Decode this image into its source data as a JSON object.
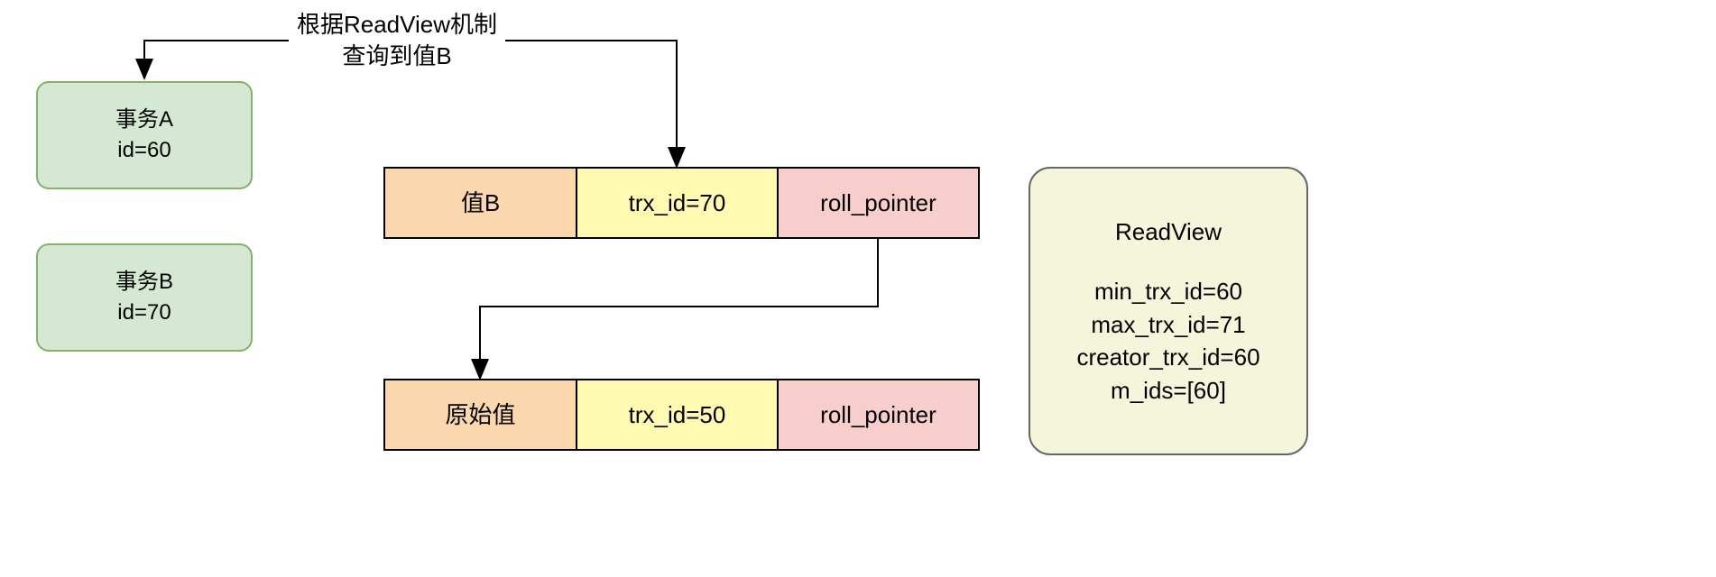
{
  "annotation": {
    "line1": "根据ReadView机制",
    "line2": "查询到值B"
  },
  "transactions": {
    "a": {
      "title": "事务A",
      "id_line": "id=60"
    },
    "b": {
      "title": "事务B",
      "id_line": "id=70"
    }
  },
  "rows": {
    "top": {
      "value": "值B",
      "trx_id": "trx_id=70",
      "roll_ptr": "roll_pointer"
    },
    "bottom": {
      "value": "原始值",
      "trx_id": "trx_id=50",
      "roll_ptr": "roll_pointer"
    }
  },
  "readview": {
    "title": "ReadView",
    "min_trx_id": "min_trx_id=60",
    "max_trx_id": "max_trx_id=71",
    "creator_trx_id": "creator_trx_id=60",
    "m_ids": "m_ids=[60]"
  }
}
